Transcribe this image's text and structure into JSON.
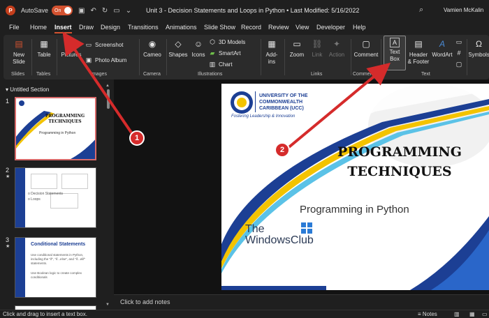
{
  "titlebar": {
    "autosave_label": "AutoSave",
    "autosave_state": "On",
    "document_title": "Unit 3 - Decision Statements and Loops in Python  •  Last Modified: 5/16/2022",
    "user_name": "Vamien McKalin"
  },
  "menu": {
    "tabs": [
      "File",
      "Home",
      "Insert",
      "Draw",
      "Design",
      "Transitions",
      "Animations",
      "Slide Show",
      "Record",
      "Review",
      "View",
      "Developer",
      "Help"
    ],
    "active": "Insert"
  },
  "ribbon": {
    "new_slide": "New\nSlide",
    "table": "Table",
    "pictures": "Pictures",
    "screenshot": "Screenshot",
    "photo_album": "Photo Album",
    "cameo": "Cameo",
    "shapes": "Shapes",
    "icons": "Icons",
    "models_3d": "3D Models",
    "smartart": "SmartArt",
    "chart": "Chart",
    "addins": "Add-\nins",
    "zoom": "Zoom",
    "link": "Link",
    "action": "Action",
    "comment": "Comment",
    "text_box": "Text\nBox",
    "header_footer": "Header\n& Footer",
    "wordart": "WordArt",
    "symbols": "Symbols",
    "groups": {
      "slides": "Slides",
      "tables": "Tables",
      "images": "Images",
      "camera": "Camera",
      "illustrations": "Illustrations",
      "links": "Links",
      "comments": "Comments",
      "text": "Text"
    }
  },
  "slide_panel": {
    "section": "Untitled Section",
    "slides": [
      {
        "number": "1",
        "title": "PROGRAMMING TECHNIQUES",
        "subtitle": "Programming in Python"
      },
      {
        "number": "2",
        "lines": [
          "o Decision Statements",
          "o Loops"
        ]
      },
      {
        "number": "3",
        "title": "Conditional Statements",
        "bullets": [
          "Use conditional statements in Python, including the \"if\", \"if...else\", and \"if...elif\" statements.",
          "Use Boolean logic to create complex conditionals"
        ]
      }
    ]
  },
  "slide": {
    "university": "UNIVERSITY OF THE COMMONWEALTH CARIBBEAN (UCC)",
    "tagline": "Fostering Leadership & Innovation",
    "title_line1": "PROGRAMMING",
    "title_line2": "TECHNIQUES",
    "subtitle": "Programming in Python",
    "watermark_line1": "The",
    "watermark_line2": "WindowsClub"
  },
  "notes_placeholder": "Click to add notes",
  "status": {
    "hint": "Click and drag to insert a text box.",
    "notes": "Notes"
  },
  "annotations": {
    "badge1": "1",
    "badge2": "2",
    "color": "#d52b2b"
  }
}
